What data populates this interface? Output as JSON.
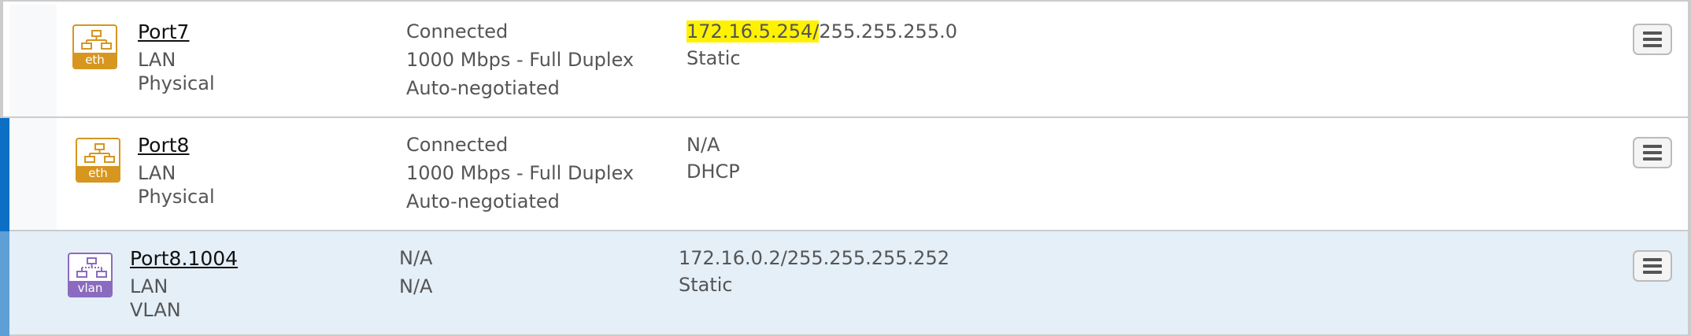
{
  "rows": [
    {
      "icon": {
        "name": "ethernet-icon",
        "label": "eth"
      },
      "name": "Port7",
      "zone": "LAN",
      "type": "Physical",
      "status": "Connected",
      "speed": "1000 Mbps - Full Duplex",
      "negotiation": "Auto-negotiated",
      "ip_highlight": "172.16.5.254/",
      "ip_rest": "255.255.255.0",
      "ip_mode": "Static"
    },
    {
      "icon": {
        "name": "ethernet-icon",
        "label": "eth"
      },
      "name": "Port8",
      "zone": "LAN",
      "type": "Physical",
      "status": "Connected",
      "speed": "1000 Mbps - Full Duplex",
      "negotiation": "Auto-negotiated",
      "ip_highlight": "",
      "ip_rest": "N/A",
      "ip_mode": "DHCP"
    },
    {
      "icon": {
        "name": "vlan-icon",
        "label": "vlan"
      },
      "name": "Port8.1004",
      "zone": "LAN",
      "type": "VLAN",
      "status": "N/A",
      "speed": "N/A",
      "negotiation": "",
      "ip_highlight": "",
      "ip_rest": "172.16.0.2/255.255.255.252",
      "ip_mode": "Static"
    }
  ],
  "colors": {
    "eth_icon": "#d7961f",
    "vlan_icon": "#8b6bbf",
    "selected_row_bg": "#e4eff8",
    "accent_blue": "#0b6fc5",
    "highlight": "#fff200"
  }
}
